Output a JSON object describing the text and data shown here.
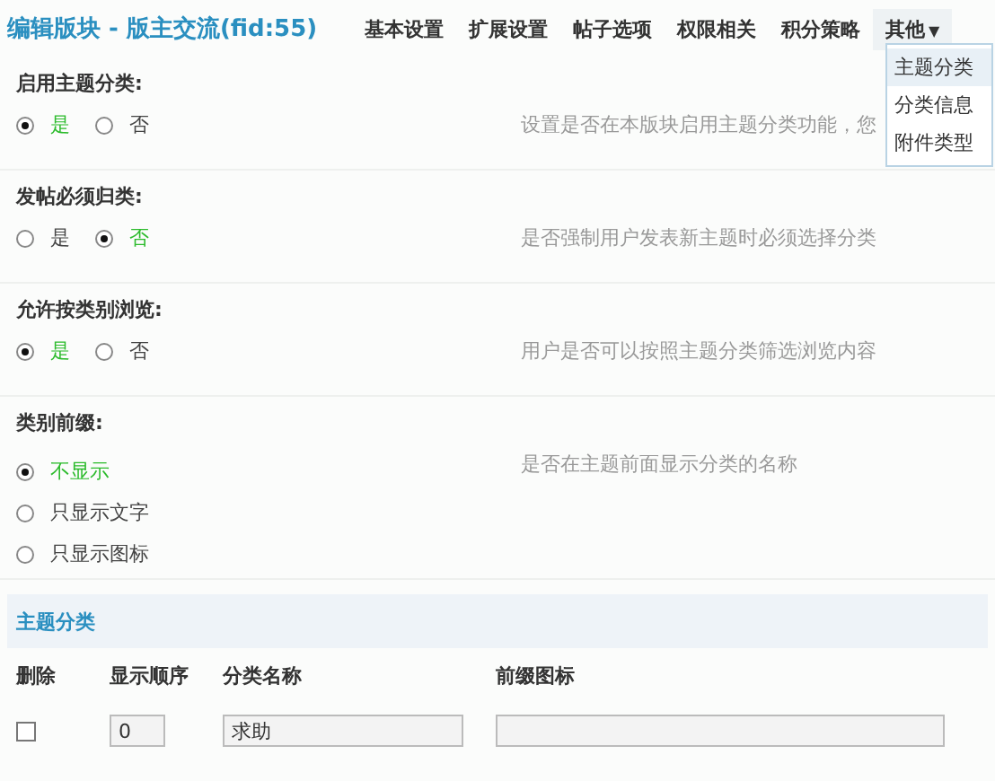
{
  "header": {
    "title": "编辑版块 - 版主交流(fid:55)",
    "tabs": [
      {
        "label": "基本设置",
        "selected": false
      },
      {
        "label": "扩展设置",
        "selected": false
      },
      {
        "label": "帖子选项",
        "selected": false
      },
      {
        "label": "权限相关",
        "selected": false
      },
      {
        "label": "积分策略",
        "selected": false
      },
      {
        "label": "其他",
        "selected": true,
        "caret": "▼"
      }
    ]
  },
  "dropdown": {
    "items": [
      {
        "label": "主题分类",
        "selected": true
      },
      {
        "label": "分类信息",
        "selected": false
      },
      {
        "label": "附件类型",
        "selected": false
      }
    ]
  },
  "settings": [
    {
      "label": "启用主题分类:",
      "kind": "inline",
      "options": [
        {
          "label": "是",
          "selected": true
        },
        {
          "label": "否",
          "selected": false
        }
      ],
      "description": "设置是否在本版块启用主题分类功能，您"
    },
    {
      "label": "发帖必须归类:",
      "kind": "inline",
      "options": [
        {
          "label": "是",
          "selected": false
        },
        {
          "label": "否",
          "selected": true
        }
      ],
      "description": "是否强制用户发表新主题时必须选择分类"
    },
    {
      "label": "允许按类别浏览:",
      "kind": "inline",
      "options": [
        {
          "label": "是",
          "selected": true
        },
        {
          "label": "否",
          "selected": false
        }
      ],
      "description": "用户是否可以按照主题分类筛选浏览内容"
    },
    {
      "label": "类别前缀:",
      "kind": "stacked",
      "options": [
        {
          "label": "不显示",
          "selected": true
        },
        {
          "label": "只显示文字",
          "selected": false
        },
        {
          "label": "只显示图标",
          "selected": false
        }
      ],
      "description": "是否在主题前面显示分类的名称"
    }
  ],
  "section": {
    "title": "主题分类",
    "columns": [
      "删除",
      "显示顺序",
      "分类名称",
      "前缀图标"
    ],
    "rows": [
      {
        "checked": false,
        "order": "0",
        "name": "求助"
      }
    ]
  }
}
